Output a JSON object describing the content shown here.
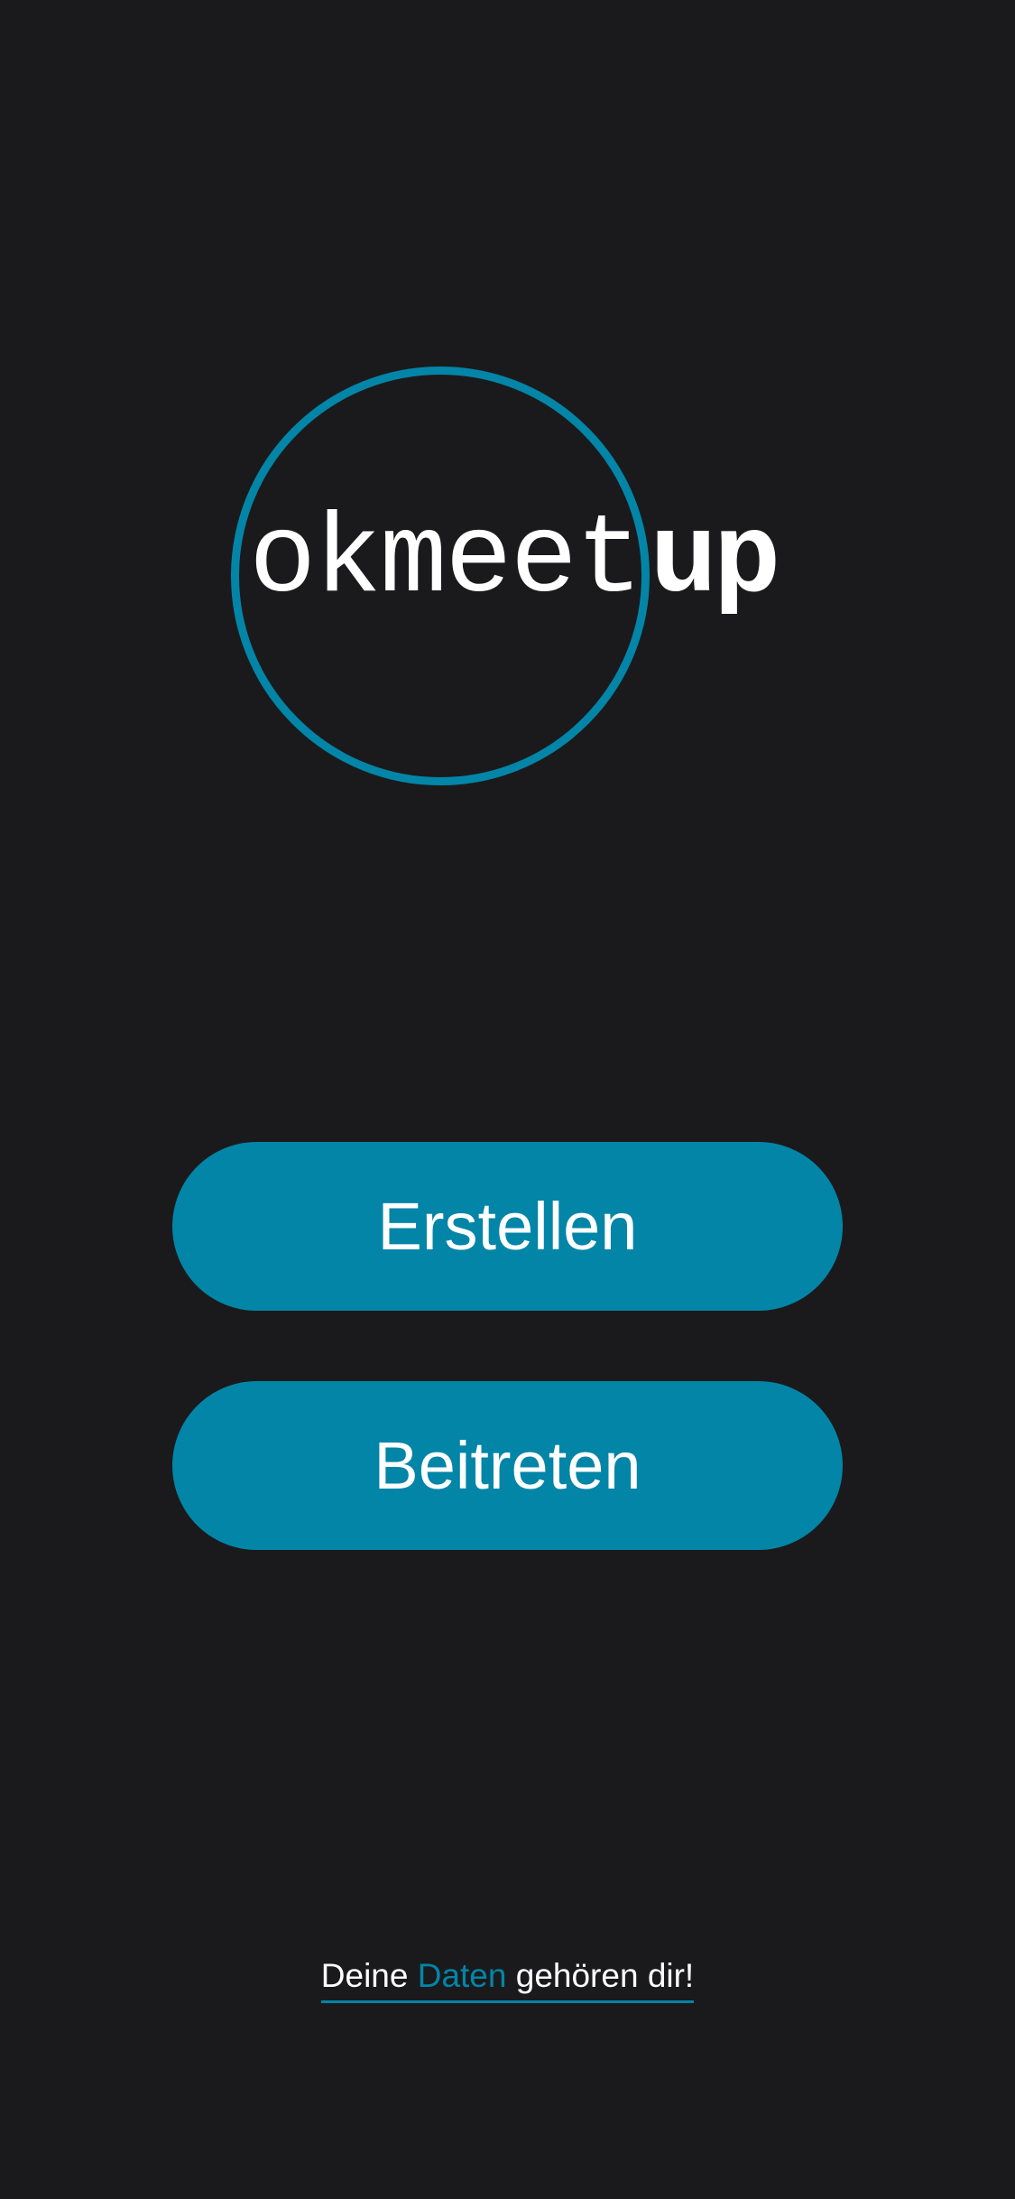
{
  "logo": {
    "text_light": "okmeet",
    "text_bold": "up"
  },
  "buttons": {
    "create_label": "Erstellen",
    "join_label": "Beitreten"
  },
  "footer": {
    "part1": "Deine ",
    "accent": "Daten",
    "part2": " gehören dir!"
  },
  "colors": {
    "background": "#1a1a1c",
    "accent": "#0385a7",
    "text": "#ffffff"
  }
}
